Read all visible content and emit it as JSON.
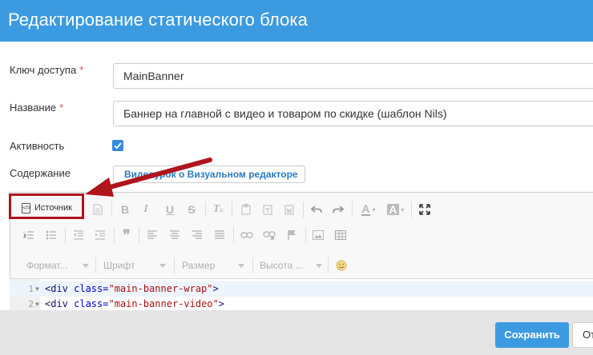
{
  "header": {
    "title": "Редактирование статического блока"
  },
  "form": {
    "access_key": {
      "label": "Ключ доступа",
      "required": "*",
      "value": "MainBanner"
    },
    "name": {
      "label": "Название",
      "required": "*",
      "value": "Баннер на главной с видео и товаром по скидке (шаблон Nils)"
    },
    "active": {
      "label": "Активность",
      "checked": true
    },
    "content": {
      "label": "Содержание",
      "video_link": "Видеоурок о Визуальном редакторе"
    }
  },
  "toolbar": {
    "source_label": "Источник",
    "format_label": "Формат...",
    "font_label": "Шрифт",
    "size_label": "Размер",
    "height_label": "Высота ..."
  },
  "code_lines": [
    {
      "num": "1",
      "tag": "<div ",
      "attr": "class=",
      "value": "\"main-banner-wrap\"",
      "end": ">"
    },
    {
      "num": "2",
      "tag": "<div ",
      "attr": "class=",
      "value": "\"main-banner-video\"",
      "end": ">"
    }
  ],
  "footer": {
    "save_label": "Сохранить",
    "cancel_label": "От"
  },
  "colors": {
    "accent": "#3c9be0",
    "highlight": "#b0141c"
  }
}
